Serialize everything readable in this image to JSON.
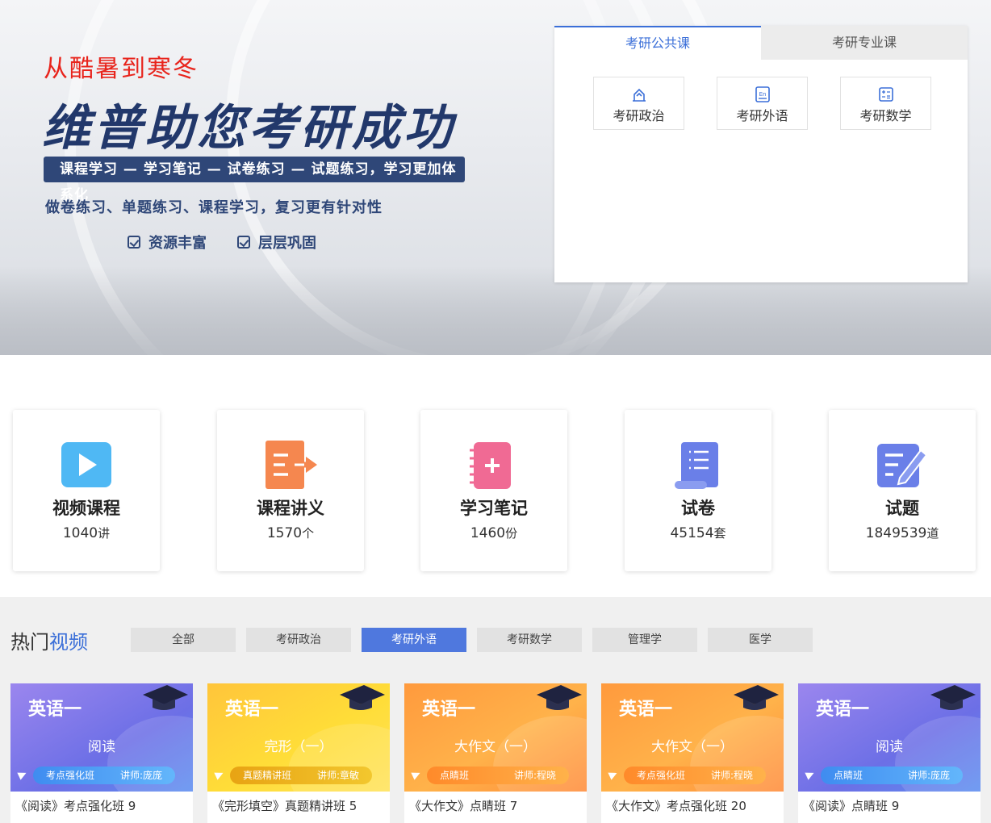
{
  "hero": {
    "tagline": "从酷暑到寒冬",
    "title": "维普助您考研成功",
    "band": "课程学习 — 学习笔记 — 试卷练习 — 试题练习，学习更加体系化",
    "line": "做卷练习、单题练习、课程学习，复习更有针对性",
    "check1": "资源丰富",
    "check2": "层层巩固"
  },
  "panel": {
    "tabs": [
      "考研公共课",
      "考研专业课"
    ],
    "subjects": [
      {
        "label": "考研政治",
        "icon": "politics-icon"
      },
      {
        "label": "考研外语",
        "icon": "english-icon"
      },
      {
        "label": "考研数学",
        "icon": "math-icon"
      }
    ]
  },
  "stats": [
    {
      "name": "视频课程",
      "count": "1040",
      "unit": "讲",
      "icon": "video-play-icon",
      "color": "#4fb8f4"
    },
    {
      "name": "课程讲义",
      "count": "1570",
      "unit": "个",
      "icon": "handout-icon",
      "color": "#f5874f"
    },
    {
      "name": "学习笔记",
      "count": "1460",
      "unit": "份",
      "icon": "notebook-icon",
      "color": "#f06a94"
    },
    {
      "name": "试卷",
      "count": "45154",
      "unit": "套",
      "icon": "exam-scroll-icon",
      "color": "#6a7fe8"
    },
    {
      "name": "试题",
      "count": "1849539",
      "unit": "道",
      "icon": "question-edit-icon",
      "color": "#6a7fe8"
    }
  ],
  "hot": {
    "title_a": "热门",
    "title_b": "视频",
    "tabs": [
      "全部",
      "考研政治",
      "考研外语",
      "考研数学",
      "管理学",
      "医学"
    ],
    "active_tab": "考研外语",
    "cards": [
      {
        "lang": "英语一",
        "topic": "阅读",
        "cls": "考点强化班",
        "teacher": "讲师:庞庞",
        "caption": "《阅读》考点强化班 9"
      },
      {
        "lang": "英语一",
        "topic": "完形（一）",
        "cls": "真题精讲班",
        "teacher": "讲师:章敏",
        "caption": "《完形填空》真题精讲班 5"
      },
      {
        "lang": "英语一",
        "topic": "大作文（一）",
        "cls": "点睛班",
        "teacher": "讲师:程晓",
        "caption": "《大作文》点睛班 7"
      },
      {
        "lang": "英语一",
        "topic": "大作文（一）",
        "cls": "考点强化班",
        "teacher": "讲师:程晓",
        "caption": "《大作文》考点强化班 20"
      },
      {
        "lang": "英语一",
        "topic": "阅读",
        "cls": "点睛班",
        "teacher": "讲师:庞庞",
        "caption": "《阅读》点睛班 9"
      }
    ]
  }
}
